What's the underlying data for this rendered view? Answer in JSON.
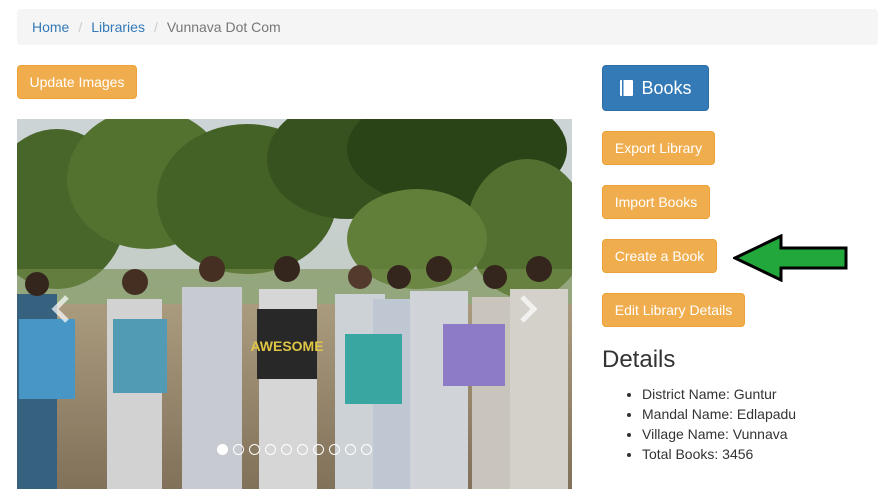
{
  "breadcrumb": {
    "home": "Home",
    "libraries": "Libraries",
    "current": "Vunnava Dot Com",
    "separator": "/"
  },
  "buttons": {
    "update_images": "Update Images",
    "books": "Books",
    "export_library": "Export Library",
    "import_books": "Import Books",
    "create_book": "Create a Book",
    "edit_library": "Edit Library Details"
  },
  "carousel": {
    "slide_count": 10,
    "active_index": 0,
    "prev_icon": "chevron-left-icon",
    "next_icon": "chevron-right-icon",
    "poster_text": "AWESOME"
  },
  "details": {
    "title": "Details",
    "items": [
      "District Name: Guntur",
      "Mandal Name: Edlapadu",
      "Village Name: Vunnava",
      "Total Books: 3456"
    ]
  },
  "colors": {
    "primary": "#337ab7",
    "warning": "#f0ad4e",
    "arrow": "#22a83a"
  }
}
